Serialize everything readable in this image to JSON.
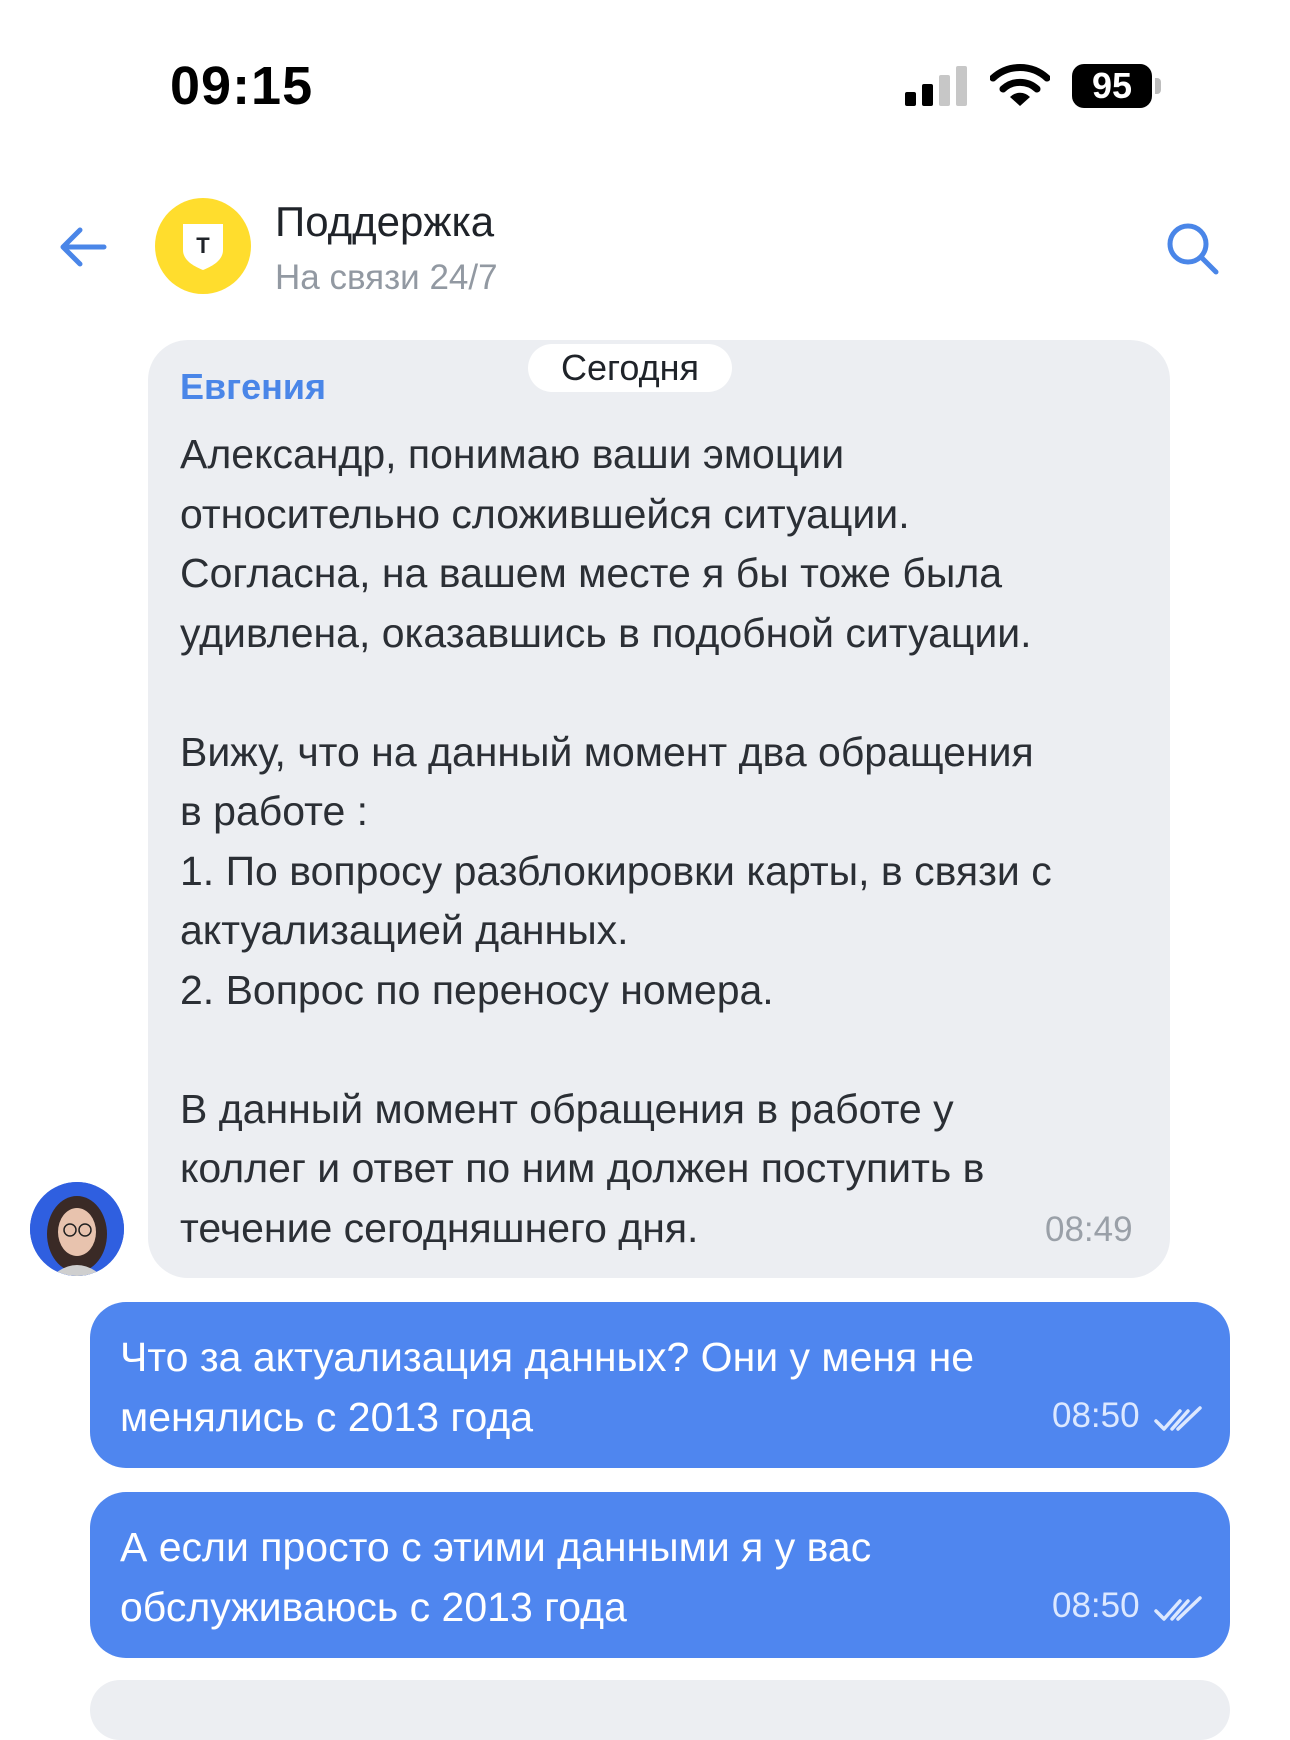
{
  "status_bar": {
    "time": "09:15",
    "battery": "95"
  },
  "header": {
    "title": "Поддержка",
    "subtitle": "На связи 24/7",
    "logo_letter": "T"
  },
  "date_divider": "Сегодня",
  "messages": [
    {
      "direction": "incoming",
      "sender": "Евгения",
      "text": "Александр, понимаю ваши эмоции\nотносительно сложившейся ситуации.\nСогласна, на вашем месте я бы тоже была\nудивлена, оказавшись в подобной ситуации.\n\nВижу, что на данный момент два обращения\nв работе :\n1. По вопросу разблокировки карты, в связи с\nактуализацией данных.\n2. Вопрос по переносу номера.\n\nВ данный момент обращения в работе у\nколлег и ответ по ним должен поступить в\nтечение сегодняшнего дня.",
      "time": "08:49"
    },
    {
      "direction": "outgoing",
      "text": "Что за актуализация данных? Они у меня не менялись с 2013 года",
      "time": "08:50",
      "status": "read"
    },
    {
      "direction": "outgoing",
      "text": "А если просто с этими данными я у вас обслуживаюсь с 2013 года",
      "time": "08:50",
      "status": "read"
    }
  ],
  "colors": {
    "accent": "#4f86ef",
    "sender": "#4a86e8",
    "incoming_bg": "#eceef2",
    "logo_yellow": "#ffdd2d"
  },
  "icons": [
    "back-arrow-icon",
    "search-icon",
    "signal-icon",
    "wifi-icon",
    "battery-icon",
    "double-check-icon"
  ]
}
